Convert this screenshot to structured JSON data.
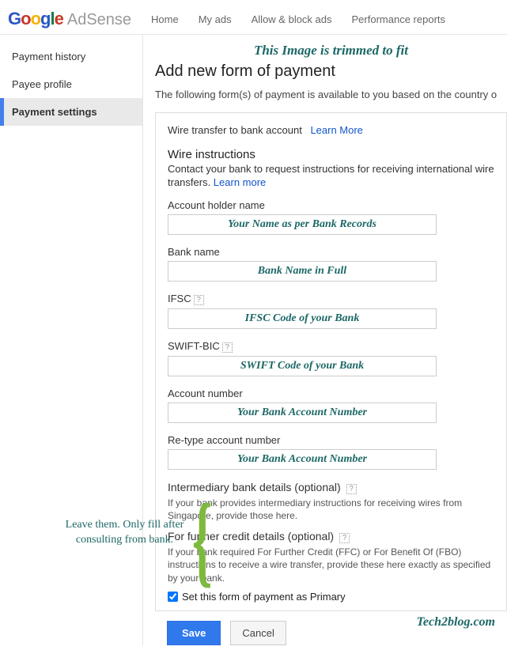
{
  "header": {
    "logo": "Google",
    "brand": "AdSense",
    "nav": [
      "Home",
      "My ads",
      "Allow & block ads",
      "Performance reports"
    ]
  },
  "sidebar": {
    "items": [
      "Payment history",
      "Payee profile",
      "Payment settings"
    ],
    "active_index": 2
  },
  "annotations": {
    "trim_note": "This Image is trimmed to fit",
    "brace_note": "Leave them. Only fill after consulting from bank.",
    "watermark": "Tech2blog.com"
  },
  "page": {
    "title": "Add new form of payment",
    "intro": "The following form(s) of payment is available to you based on the country o"
  },
  "panel": {
    "header": "Wire transfer to bank account",
    "learn_more": "Learn More",
    "wire_title": "Wire instructions",
    "wire_desc_1": "Contact your bank to request instructions for receiving international wire transfers. ",
    "wire_learn_more": "Learn more",
    "fields": {
      "account_holder": {
        "label": "Account holder name",
        "hint": "Your Name as per Bank Records"
      },
      "bank_name": {
        "label": "Bank name",
        "hint": "Bank Name in Full"
      },
      "ifsc": {
        "label": "IFSC",
        "help": true,
        "hint": "IFSC Code of your Bank"
      },
      "swift": {
        "label": "SWIFT-BIC",
        "help": true,
        "hint": "SWIFT Code of your Bank"
      },
      "account_number": {
        "label": "Account number",
        "hint": "Your Bank Account Number"
      },
      "retype_account": {
        "label": "Re-type account number",
        "hint": "Your Bank Account Number"
      }
    },
    "intermediary": {
      "title": "Intermediary bank details (optional)",
      "desc": "If your bank provides intermediary instructions for receiving wires from Singapore, provide those here."
    },
    "ffc": {
      "title": "For further credit details (optional)",
      "desc": "If your bank required For Further Credit (FFC) or For Benefit Of (FBO) instructions to receive a wire transfer, provide these here exactly as specified by your bank."
    },
    "primary_label": "Set this form of payment as Primary",
    "primary_checked": true
  },
  "buttons": {
    "save": "Save",
    "cancel": "Cancel"
  }
}
